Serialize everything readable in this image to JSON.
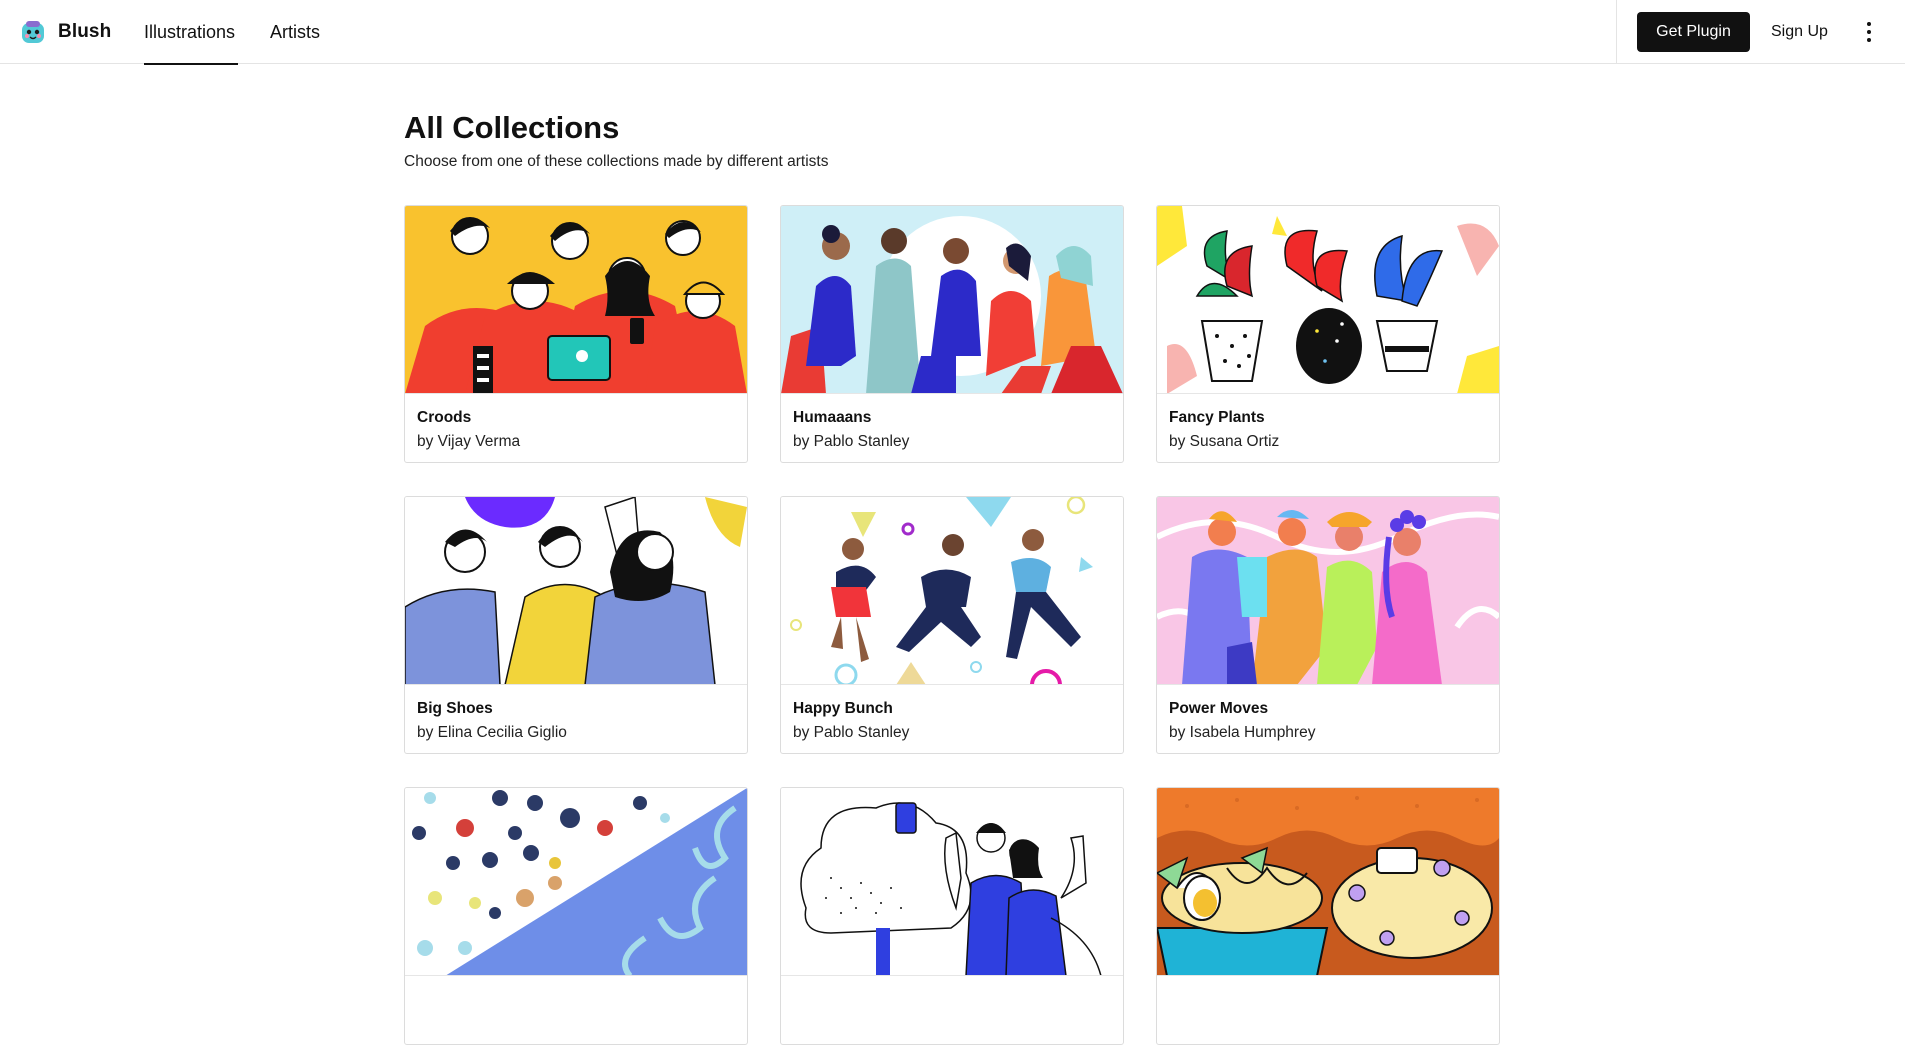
{
  "brand": {
    "name": "Blush"
  },
  "nav": {
    "tabs": [
      {
        "label": "Illustrations",
        "active": true
      },
      {
        "label": "Artists",
        "active": false
      }
    ],
    "get_plugin_label": "Get Plugin",
    "sign_up_label": "Sign Up",
    "more_icon": "vertical-ellipsis-icon"
  },
  "page": {
    "title": "All Collections",
    "subtitle": "Choose from one of these collections made by different artists"
  },
  "collections": [
    {
      "title": "Croods",
      "author": "by Vijay Verma",
      "accent": "#F9C22E"
    },
    {
      "title": "Humaaans",
      "author": "by Pablo Stanley",
      "accent": "#CFEFF7"
    },
    {
      "title": "Fancy Plants",
      "author": "by Susana Ortiz",
      "accent": "#FFE83A"
    },
    {
      "title": "Big Shoes",
      "author": "by Elina Cecilia Giglio",
      "accent": "#6B2BFF"
    },
    {
      "title": "Happy Bunch",
      "author": "by Pablo Stanley",
      "accent": "#1E2A5A"
    },
    {
      "title": "Power Moves",
      "author": "by Isabela Humphrey",
      "accent": "#F9C6E6"
    },
    {
      "title": "",
      "author": "",
      "accent": "#6E8EE8"
    },
    {
      "title": "",
      "author": "",
      "accent": "#2F3FE0"
    },
    {
      "title": "",
      "author": "",
      "accent": "#EE7A2B"
    }
  ]
}
